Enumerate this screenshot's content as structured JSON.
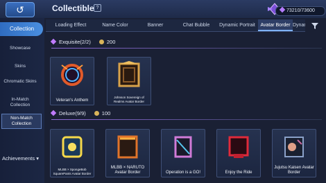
{
  "header": {
    "title": "Collectible",
    "currency": "73210/73600"
  },
  "tabs": [
    "Loading Effect",
    "Name Color",
    "Banner",
    "Chat Bubble",
    "Dynamic Portrait",
    "Avatar Border",
    "Dynami"
  ],
  "sidebar": {
    "category": "Collection",
    "items": [
      "Showcase",
      "Skins",
      "Chromatic Skins",
      "In-Match Collection",
      "Non-Match Collection"
    ],
    "achievements": "Achievements"
  },
  "sections": [
    {
      "label": "Exquisite(2/2)",
      "price": "200",
      "cards": [
        {
          "name": "Veteran's Anthem"
        },
        {
          "name": "Johnson Sovereign of Realms Avatar Border"
        }
      ]
    },
    {
      "label": "Deluxe(9/9)",
      "price": "100",
      "cards": [
        {
          "name": "MLBB × SpongeBob SquarePants Avatar Border"
        },
        {
          "name": "MLBB × NARUTO Avatar Border"
        },
        {
          "name": "Operation is a GO!"
        },
        {
          "name": "Enjoy the Ride"
        },
        {
          "name": "Jujutsu Kaisen Avatar Border"
        }
      ]
    }
  ],
  "colors": {
    "accent": "#4a8fe0",
    "active_tab": "#2e3e66",
    "gem": "#c07bff",
    "coin": "#d9b45a"
  }
}
